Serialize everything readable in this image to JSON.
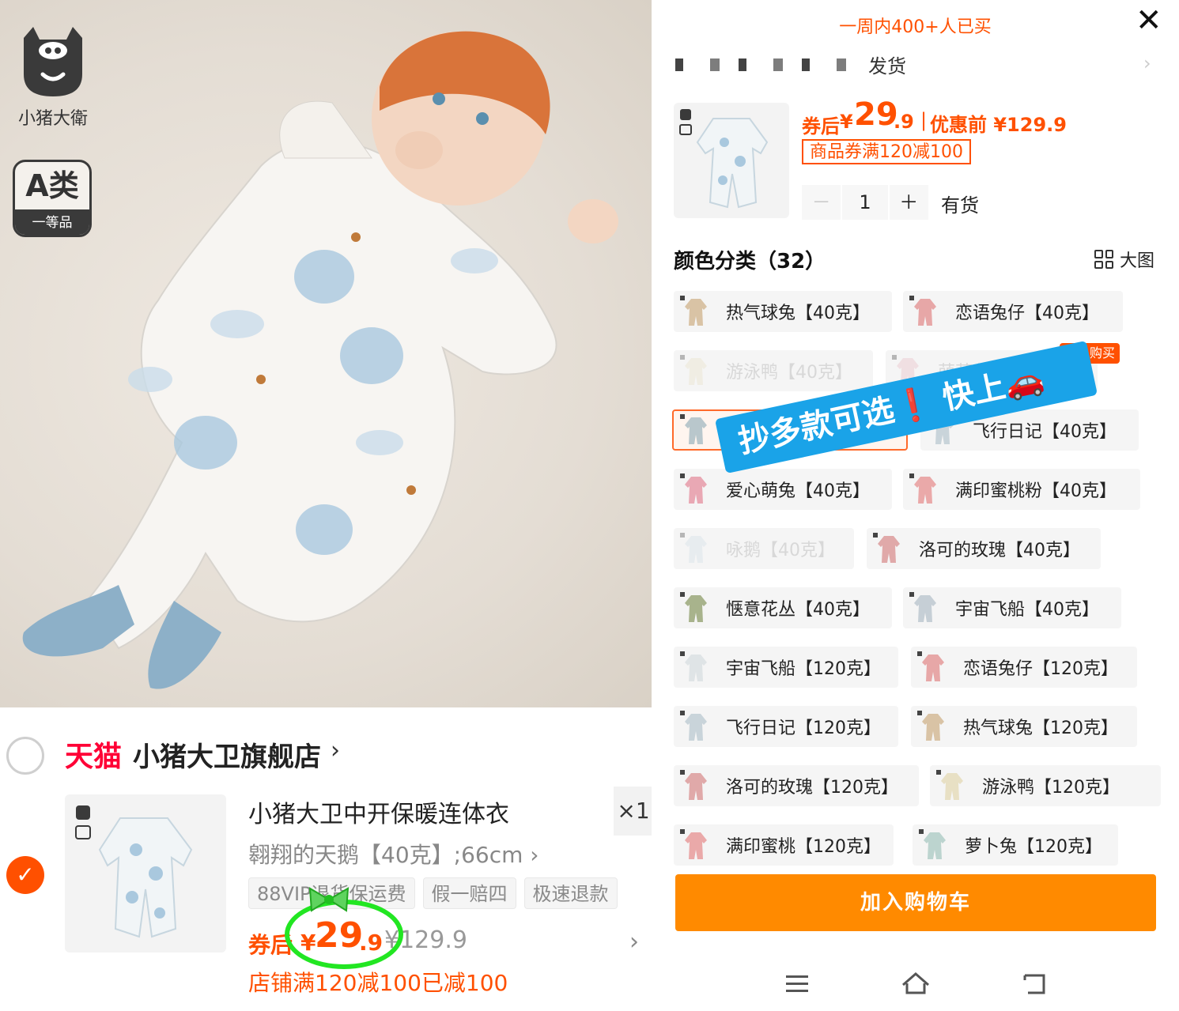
{
  "left": {
    "brand_logo_text": "小猪大衛",
    "grade_badge": {
      "main": "A类",
      "sub": "一等品"
    },
    "store": {
      "platform": "天猫",
      "name": "小猪大卫旗舰店",
      "chevron": "›"
    },
    "item": {
      "title": "小猪大卫中开保暖连体衣",
      "quantity": "×1",
      "sku": "翱翔的天鹅【40克】;66cm ›",
      "tags": [
        "88VIP退货保运费",
        "假一赔四",
        "极速退款"
      ],
      "price": {
        "coupon_label": "券后",
        "yen": "¥",
        "integer": "29",
        "decimal": ".9",
        "original": "¥129.9",
        "chevron": "›"
      },
      "discount_note": "店铺满120减100已减100",
      "checked_glyph": "✓"
    }
  },
  "right": {
    "sold_count": "一周内400+人已买",
    "close_glyph": "✕",
    "shipping": {
      "text": "发货",
      "chevron": "›"
    },
    "selected_price": {
      "coupon_label": "券后",
      "yen": "¥",
      "integer": "29",
      "decimal": ".9",
      "separator": "|",
      "before_label": "优惠前 ¥129.9"
    },
    "coupon_tag": "商品券满120减100",
    "stepper": {
      "minus": "－",
      "value": "1",
      "plus": "＋"
    },
    "stock": "有货",
    "color_heading": "颜色分类（32）",
    "big_view_label": "大图",
    "hot_tag": "百人购买",
    "banner": {
      "text": "抄多款可选",
      "bang": "❗",
      "text2": "快上",
      "car": "🚗"
    },
    "options": [
      {
        "label": "热气球兔【40克】",
        "state": "normal"
      },
      {
        "label": "恋语兔仔【40克】",
        "state": "normal"
      },
      {
        "label": "游泳鸭【40克】",
        "state": "dim"
      },
      {
        "label": "萌萌兔【40克】",
        "state": "dim"
      },
      {
        "label": "",
        "state": "selected"
      },
      {
        "label": "飞行日记【40克】",
        "state": "normal"
      },
      {
        "label": "爱心萌兔【40克】",
        "state": "normal"
      },
      {
        "label": "满印蜜桃粉【40克】",
        "state": "normal"
      },
      {
        "label": "咏鹅【40克】",
        "state": "dim"
      },
      {
        "label": "洛可的玫瑰【40克】",
        "state": "normal"
      },
      {
        "label": "惬意花丛【40克】",
        "state": "normal"
      },
      {
        "label": "宇宙飞船【40克】",
        "state": "normal"
      },
      {
        "label": "宇宙飞船【120克】",
        "state": "normal"
      },
      {
        "label": "恋语兔仔【120克】",
        "state": "normal"
      },
      {
        "label": "飞行日记【120克】",
        "state": "normal"
      },
      {
        "label": "热气球兔【120克】",
        "state": "normal"
      },
      {
        "label": "洛可的玫瑰【120克】",
        "state": "normal"
      },
      {
        "label": "游泳鸭【120克】",
        "state": "normal"
      },
      {
        "label": "满印蜜桃【120克】",
        "state": "normal"
      },
      {
        "label": "萝卜兔【120克】",
        "state": "normal"
      }
    ],
    "add_to_cart": "加入购物车"
  },
  "colors": {
    "accent": "#ff5000",
    "tmall_red": "#ff0036",
    "cart_button": "#ff8a00",
    "banner_blue": "#1aa3e8",
    "circle_green": "#22e622"
  }
}
